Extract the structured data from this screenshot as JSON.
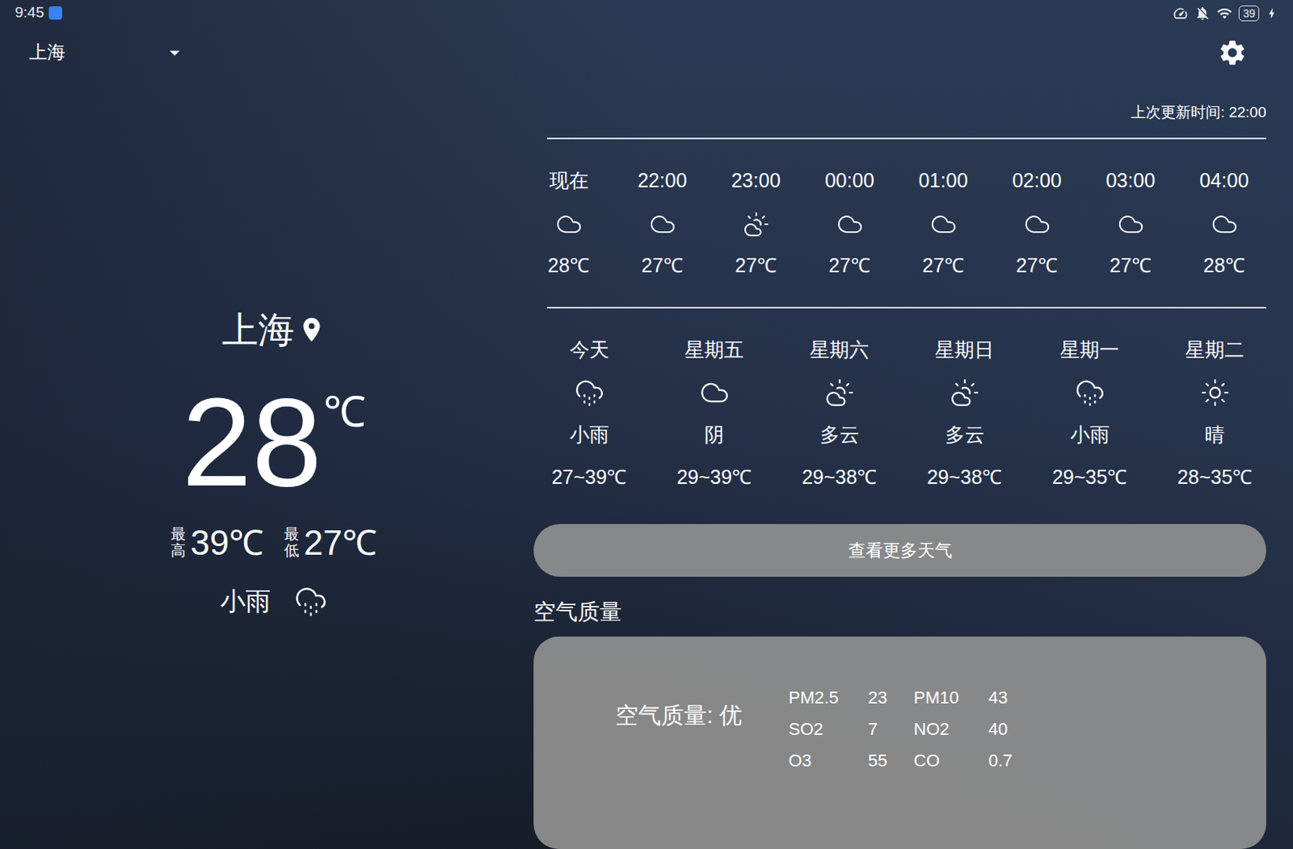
{
  "status_bar": {
    "time": "9:45",
    "battery": "39"
  },
  "city_selector": {
    "value": "上海"
  },
  "last_update": "上次更新时间: 22:00",
  "current": {
    "city": "上海",
    "temperature": "28",
    "unit": "℃",
    "high_label": "最高",
    "high": "39℃",
    "low_label": "最低",
    "low": "27℃",
    "condition": "小雨",
    "kind": "rain"
  },
  "hourly": [
    {
      "time": "现在",
      "kind": "cloudy",
      "temp": "28℃"
    },
    {
      "time": "22:00",
      "kind": "cloudy",
      "temp": "27℃"
    },
    {
      "time": "23:00",
      "kind": "partly",
      "temp": "27℃"
    },
    {
      "time": "00:00",
      "kind": "cloudy",
      "temp": "27℃"
    },
    {
      "time": "01:00",
      "kind": "cloudy",
      "temp": "27℃"
    },
    {
      "time": "02:00",
      "kind": "cloudy",
      "temp": "27℃"
    },
    {
      "time": "03:00",
      "kind": "cloudy",
      "temp": "27℃"
    },
    {
      "time": "04:00",
      "kind": "cloudy",
      "temp": "28℃"
    }
  ],
  "daily": [
    {
      "day": "今天",
      "kind": "rain",
      "condition": "小雨",
      "range": "27~39℃"
    },
    {
      "day": "星期五",
      "kind": "cloudy",
      "condition": "阴",
      "range": "29~39℃"
    },
    {
      "day": "星期六",
      "kind": "partly",
      "condition": "多云",
      "range": "29~38℃"
    },
    {
      "day": "星期日",
      "kind": "partly",
      "condition": "多云",
      "range": "29~38℃"
    },
    {
      "day": "星期一",
      "kind": "rain",
      "condition": "小雨",
      "range": "29~35℃"
    },
    {
      "day": "星期二",
      "kind": "sunny",
      "condition": "晴",
      "range": "28~35℃"
    }
  ],
  "more_button": "查看更多天气",
  "air_quality": {
    "title": "空气质量",
    "summary": "空气质量: 优",
    "metrics": [
      {
        "name": "PM2.5",
        "value": "23"
      },
      {
        "name": "PM10",
        "value": "43"
      },
      {
        "name": "SO2",
        "value": "7"
      },
      {
        "name": "NO2",
        "value": "40"
      },
      {
        "name": "O3",
        "value": "55"
      },
      {
        "name": "CO",
        "value": "0.7"
      }
    ]
  }
}
